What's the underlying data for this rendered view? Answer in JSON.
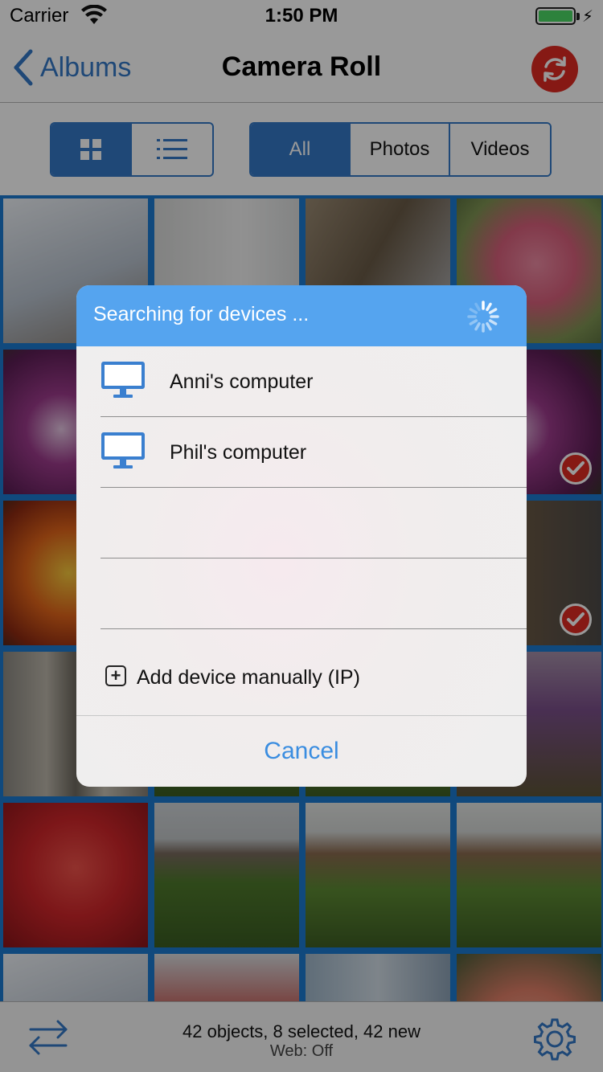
{
  "status_bar": {
    "carrier": "Carrier",
    "time": "1:50 PM",
    "wifi_icon": "wifi-icon",
    "battery_icon": "battery-icon",
    "charging_icon": "charging-icon"
  },
  "nav": {
    "back_label": "Albums",
    "title": "Camera Roll",
    "back_icon": "chevron-left-icon",
    "sync_icon": "sync-icon"
  },
  "view_toggle": {
    "options": [
      "grid-view-icon",
      "list-view-icon"
    ],
    "selected": "grid-view-icon"
  },
  "filter": {
    "options": [
      "All",
      "Photos",
      "Videos"
    ],
    "selected": "All"
  },
  "dialog": {
    "title": "Searching for devices ...",
    "devices": [
      {
        "label": "Anni's computer",
        "icon": "computer-icon"
      },
      {
        "label": "Phil's computer",
        "icon": "computer-icon"
      }
    ],
    "add_device_label": "Add device manually (IP)",
    "cancel_label": "Cancel"
  },
  "toolbar": {
    "status": "42 objects, 8 selected, 42 new",
    "web_status": "Web: Off",
    "transfer_icon": "transfer-arrows-icon",
    "settings_icon": "gear-icon"
  },
  "colors": {
    "accent": "#3478c6",
    "dialog_header": "#55a4ef",
    "sync_button": "#e02a22",
    "selection_check": "#e02a22"
  }
}
